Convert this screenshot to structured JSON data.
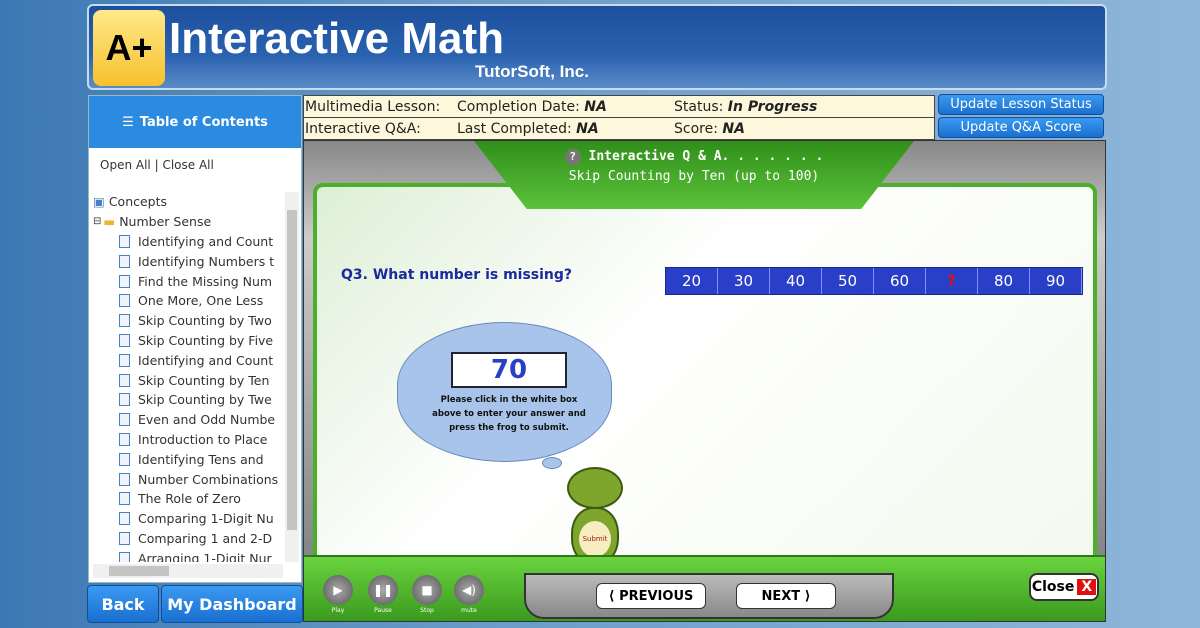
{
  "header": {
    "logo": "A+",
    "title": "Interactive Math",
    "company": "TutorSoft, Inc."
  },
  "sidebar": {
    "toc_title": "Table of Contents",
    "open_all": "Open All",
    "separator": "|",
    "close_all": "Close All",
    "root": "Concepts",
    "folder": "Number Sense",
    "items": [
      "Identifying and Count",
      "Identifying Numbers t",
      "Find the Missing Num",
      "One More, One Less",
      "Skip Counting by Two",
      "Skip Counting by Five",
      "Identifying and Count",
      "Skip Counting by Ten",
      "Skip Counting by Twe",
      "Even and Odd Numbe",
      "Introduction to Place",
      "Identifying Tens and",
      "Number Combinations",
      "The Role of Zero",
      "Comparing 1-Digit Nu",
      "Comparing 1 and 2-D",
      "Arranging 1-Digit Nur"
    ],
    "back": "Back",
    "dashboard": "My Dashboard"
  },
  "info": {
    "multimedia_label": "Multimedia Lesson:",
    "completion_label": "Completion Date:",
    "completion_value": "NA",
    "status_label": "Status:",
    "status_value": "In Progress",
    "qa_label": "Interactive Q&A:",
    "last_label": "Last Completed:",
    "last_value": "NA",
    "score_label": "Score:",
    "score_value": "NA",
    "update_status": "Update Lesson Status",
    "update_score": "Update Q&A Score"
  },
  "lesson": {
    "tab_title": "Interactive Q & A. . . . . . .",
    "subtitle": "Skip Counting by Ten (up to 100)",
    "question": "Q3. What number is missing?",
    "sequence": [
      "20",
      "30",
      "40",
      "50",
      "60",
      "?",
      "80",
      "90"
    ],
    "answer": "70",
    "hint": "Please click in the white box above to enter your answer and press the frog to submit.",
    "submit": "Submit"
  },
  "controls": {
    "play": "Play",
    "pause": "Pause",
    "stop": "Stop",
    "mute": "mute",
    "previous": "PREVIOUS",
    "next": "NEXT",
    "close": "Close",
    "close_x": "X"
  },
  "colors": {
    "accent_blue": "#2a8be0",
    "green": "#4caf2a",
    "sequence_bg": "#2a3fc8",
    "missing": "#e01010"
  }
}
